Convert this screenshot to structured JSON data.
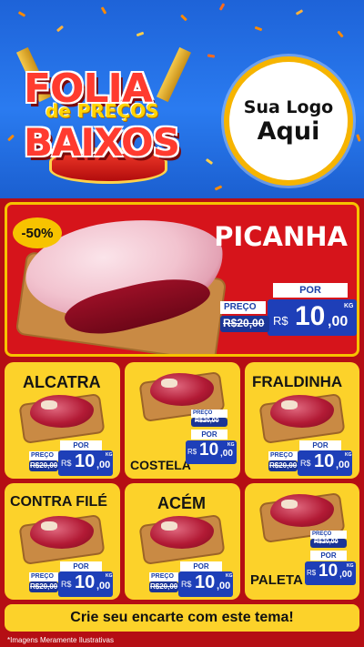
{
  "header": {
    "logo_line1": "FOLIA",
    "logo_line2": "de PREÇOS",
    "logo_line3": "BAIXOS",
    "brand_line1": "Sua Logo",
    "brand_line2": "Aqui"
  },
  "hero": {
    "title": "PICANHA",
    "discount": "-50%",
    "preco_label": "PREÇO",
    "por_label": "POR",
    "old_price": "R$20,00",
    "currency": "R$",
    "price_int": "10",
    "price_cents": ",00",
    "unit": "KG"
  },
  "products": [
    {
      "name": "ALCATRA",
      "preco_label": "PREÇO",
      "por_label": "POR",
      "old_price": "R$20,00",
      "currency": "R$",
      "price_int": "10",
      "price_cents": ",00",
      "unit": "KG"
    },
    {
      "name": "COSTELA",
      "preco_label": "PREÇO",
      "por_label": "POR",
      "old_price": "R$20,00",
      "currency": "R$",
      "price_int": "10",
      "price_cents": ",00",
      "unit": "KG"
    },
    {
      "name": "FRALDINHA",
      "preco_label": "PREÇO",
      "por_label": "POR",
      "old_price": "R$20,00",
      "currency": "R$",
      "price_int": "10",
      "price_cents": ",00",
      "unit": "KG"
    },
    {
      "name": "CONTRA FILÉ",
      "preco_label": "PREÇO",
      "por_label": "POR",
      "old_price": "R$20,00",
      "currency": "R$",
      "price_int": "10",
      "price_cents": ",00",
      "unit": "KG"
    },
    {
      "name": "ACÉM",
      "preco_label": "PREÇO",
      "por_label": "POR",
      "old_price": "R$20,00",
      "currency": "R$",
      "price_int": "10",
      "price_cents": ",00",
      "unit": "KG"
    },
    {
      "name": "PALETA",
      "preco_label": "PREÇO",
      "por_label": "POR",
      "old_price": "R$20,00",
      "currency": "R$",
      "price_int": "10",
      "price_cents": ",00",
      "unit": "KG"
    }
  ],
  "cta": "Crie seu encarte com este tema!",
  "disclaimer": "*Imagens Meramente Ilustrativas",
  "colors": {
    "header_blue": "#2a7bf0",
    "background_red": "#b50e14",
    "hero_red": "#d6141b",
    "card_yellow": "#fcd22a",
    "price_blue": "#1e3fb8"
  }
}
